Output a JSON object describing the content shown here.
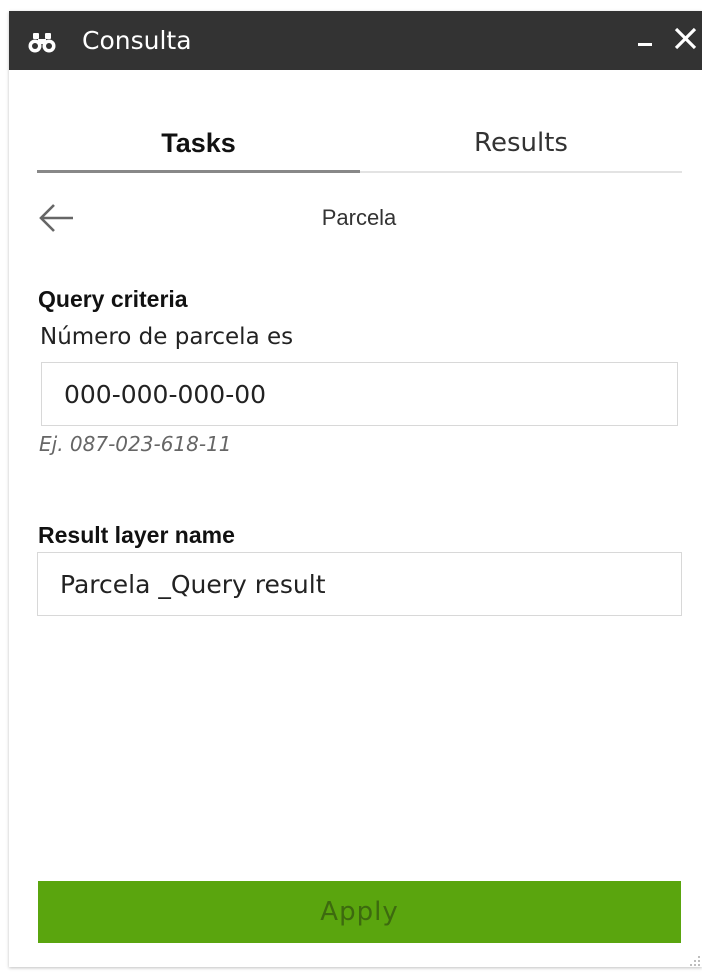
{
  "window": {
    "title": "Consulta",
    "icon": "binoculars-icon",
    "minimize_icon": "minimize-icon",
    "close_icon": "close-icon"
  },
  "tabs": [
    {
      "label": "Tasks",
      "active": true
    },
    {
      "label": "Results",
      "active": false
    }
  ],
  "nav": {
    "back_icon": "arrow-left-icon",
    "title": "Parcela"
  },
  "query": {
    "heading": "Query criteria",
    "field_label": "Número de parcela es",
    "value": "000-000-000-00",
    "hint": "Ej. 087-023-618-11"
  },
  "result_layer": {
    "heading": "Result layer name",
    "value": "Parcela _Query result"
  },
  "actions": {
    "apply_label": "Apply"
  },
  "colors": {
    "titlebar": "#333333",
    "apply_button": "#5aa50e",
    "apply_text": "#3d6a0f"
  }
}
